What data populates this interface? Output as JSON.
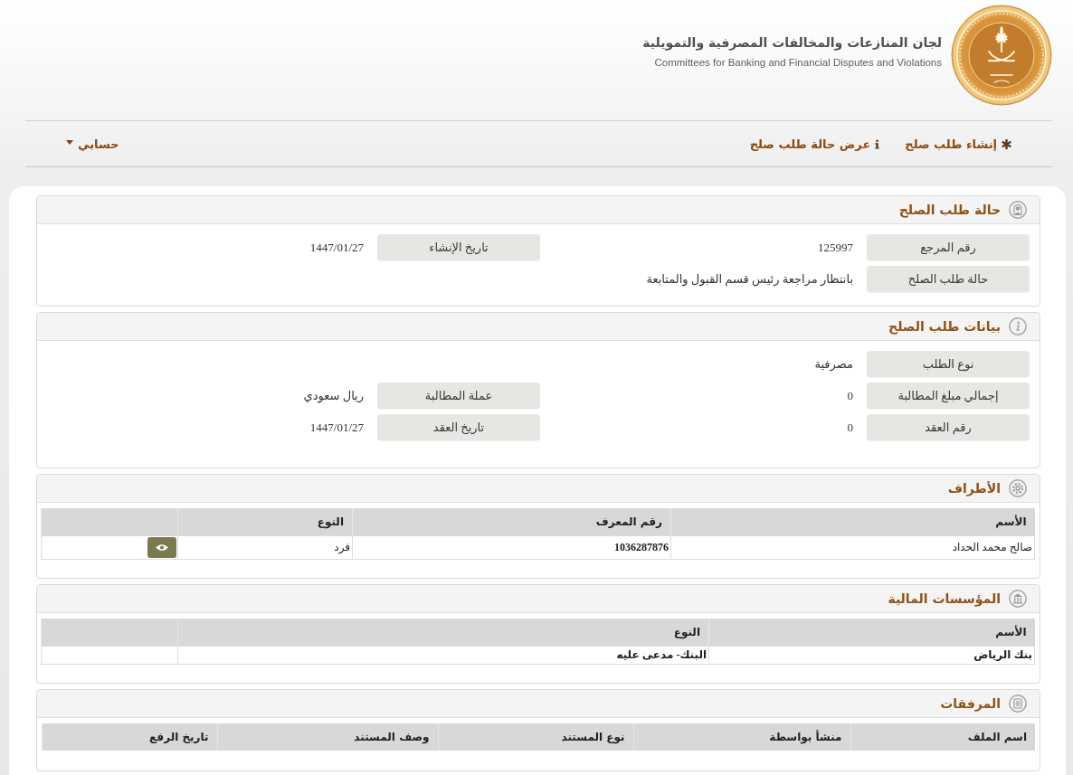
{
  "header": {
    "title": "لجان المنازعات والمخالفات المصرفية والتمويلية",
    "subtitle": "Committees for Banking and Financial Disputes and Violations"
  },
  "nav": {
    "items": [
      {
        "label": "إنشاء طلب صلح"
      },
      {
        "label": "عرض حالة طلب صلح"
      }
    ],
    "account_menu": {
      "label": "حسابي"
    }
  },
  "sections": [
    {
      "kind": "form",
      "title": "حالة طلب الصلح",
      "rows": [
        [
          {
            "label": "رقم المرجع",
            "value": "125997"
          },
          {
            "label": "تاريخ الإنشاء",
            "value": "1447/01/27"
          }
        ],
        [
          {
            "label": "حالة طلب الصلح",
            "value": "بانتظار مراجعة رئيس قسم القبول والمتابعة"
          }
        ]
      ]
    },
    {
      "kind": "form",
      "title": "بيانات طلب الصلح",
      "rows": [
        [
          {
            "label": "نوع الطلب",
            "value": "مصرفية"
          }
        ],
        [
          {
            "label": "إجمالي مبلغ المطالبة",
            "value": "0"
          },
          {
            "label": "عملة المطالبة",
            "value": "ريال سعودي"
          }
        ],
        [
          {
            "label": "رقم العقد",
            "value": "0"
          },
          {
            "label": "تاريخ العقد",
            "value": "1447/01/27"
          }
        ]
      ]
    },
    {
      "kind": "table",
      "title": "الأطراف",
      "action_column": true,
      "columns": [
        "الأسم",
        "رقم المعرف",
        "النوع"
      ],
      "rows": [
        {
          "cells": [
            {
              "text": "صالح محمد الحداد",
              "bold": false
            },
            {
              "text": "1036287876",
              "bold": true
            },
            {
              "text": "فرد",
              "bold": false
            }
          ],
          "viewable": true
        }
      ]
    },
    {
      "kind": "table",
      "title": "المؤسسات المالية",
      "action_column": true,
      "columns": [
        "الأسم",
        "النوع"
      ],
      "rows": [
        {
          "cells": [
            {
              "text": "بنك الرياض",
              "bold": true
            },
            {
              "text": "البنك- مدعى عليه",
              "bold": true
            }
          ],
          "viewable": false
        }
      ]
    },
    {
      "kind": "table",
      "title": "المرفقات",
      "columns": [
        "اسم الملف",
        "منشأ بواسطة",
        "نوع المستند",
        "وصف المستند",
        "تاريخ الرفع"
      ]
    }
  ]
}
